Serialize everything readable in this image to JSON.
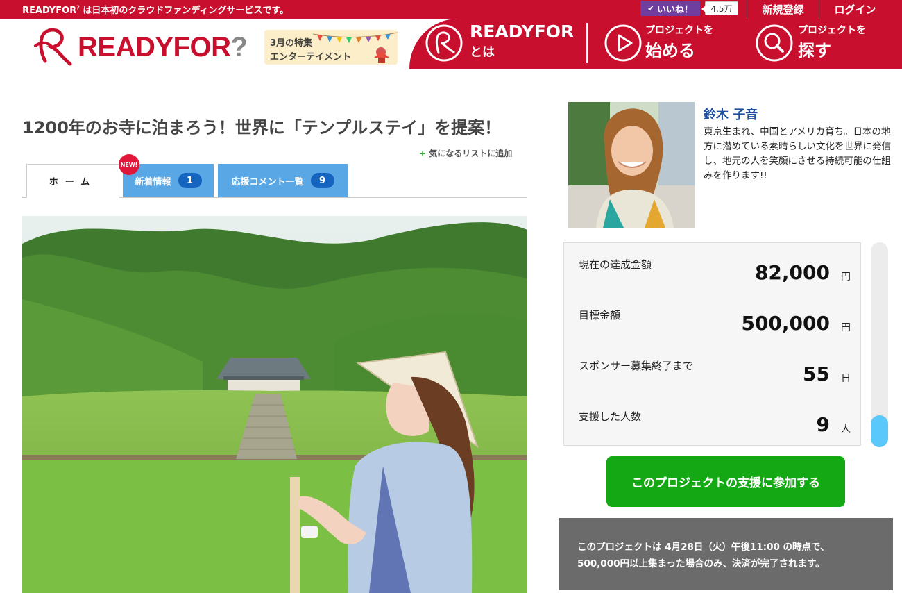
{
  "topbar": {
    "tagline": "READYFOR",
    "tagline_sup": "?",
    "tagline_rest": " は日本初のクラウドファンディングサービスです。",
    "like_label": "いいね！",
    "like_count": "4.5万",
    "signup": "新規登録",
    "login": "ログイン"
  },
  "header": {
    "logo_ready": "READY",
    "logo_for": "FOR",
    "logo_q": "?",
    "feature_line1": "3月の特集",
    "feature_line2": "エンターテイメント",
    "nav": {
      "about_big": "READYFOR",
      "about_small": "とは",
      "start_small": "プロジェクトを",
      "start_big": "始める",
      "search_small": "プロジェクトを",
      "search_big": "探す"
    }
  },
  "project": {
    "title": "1200年のお寺に泊まろう！世界に「テンプルステイ」を提案！",
    "watchlist": "気になるリストに追加",
    "new_badge": "NEW!",
    "tabs": {
      "home": "ホーム",
      "news": "新着情報",
      "news_count": "1",
      "comments": "応援コメント一覧",
      "comments_count": "9"
    }
  },
  "owner": {
    "name": "鈴木 子音",
    "bio": "東京生まれ、中国とアメリカ育ち。日本の地方に潜めている素晴らしい文化を世界に発信し、地元の人を笑顔にさせる持続可能の仕組みを作ります!!"
  },
  "stats": [
    {
      "label": "現在の達成金額",
      "value": "82,000",
      "unit": "円"
    },
    {
      "label": "目標金額",
      "value": "500,000",
      "unit": "円"
    },
    {
      "label": "スポンサー募集終了まで",
      "value": "55",
      "unit": "日"
    },
    {
      "label": "支援した人数",
      "value": "9",
      "unit": "人"
    }
  ],
  "scroll_progress": 0.85,
  "support_button": "このプロジェクトの支援に参加する",
  "notice": {
    "line1": "このプロジェクトは 4月28日（火）午後11:00 の時点で、",
    "line2": "500,000円以上集まった場合のみ、決済が完了されます。"
  },
  "colors": {
    "brand_red": "#c8102e",
    "tab_blue": "#5aa7e6",
    "support_green": "#15a815",
    "owner_name_blue": "#1e4fa0"
  }
}
